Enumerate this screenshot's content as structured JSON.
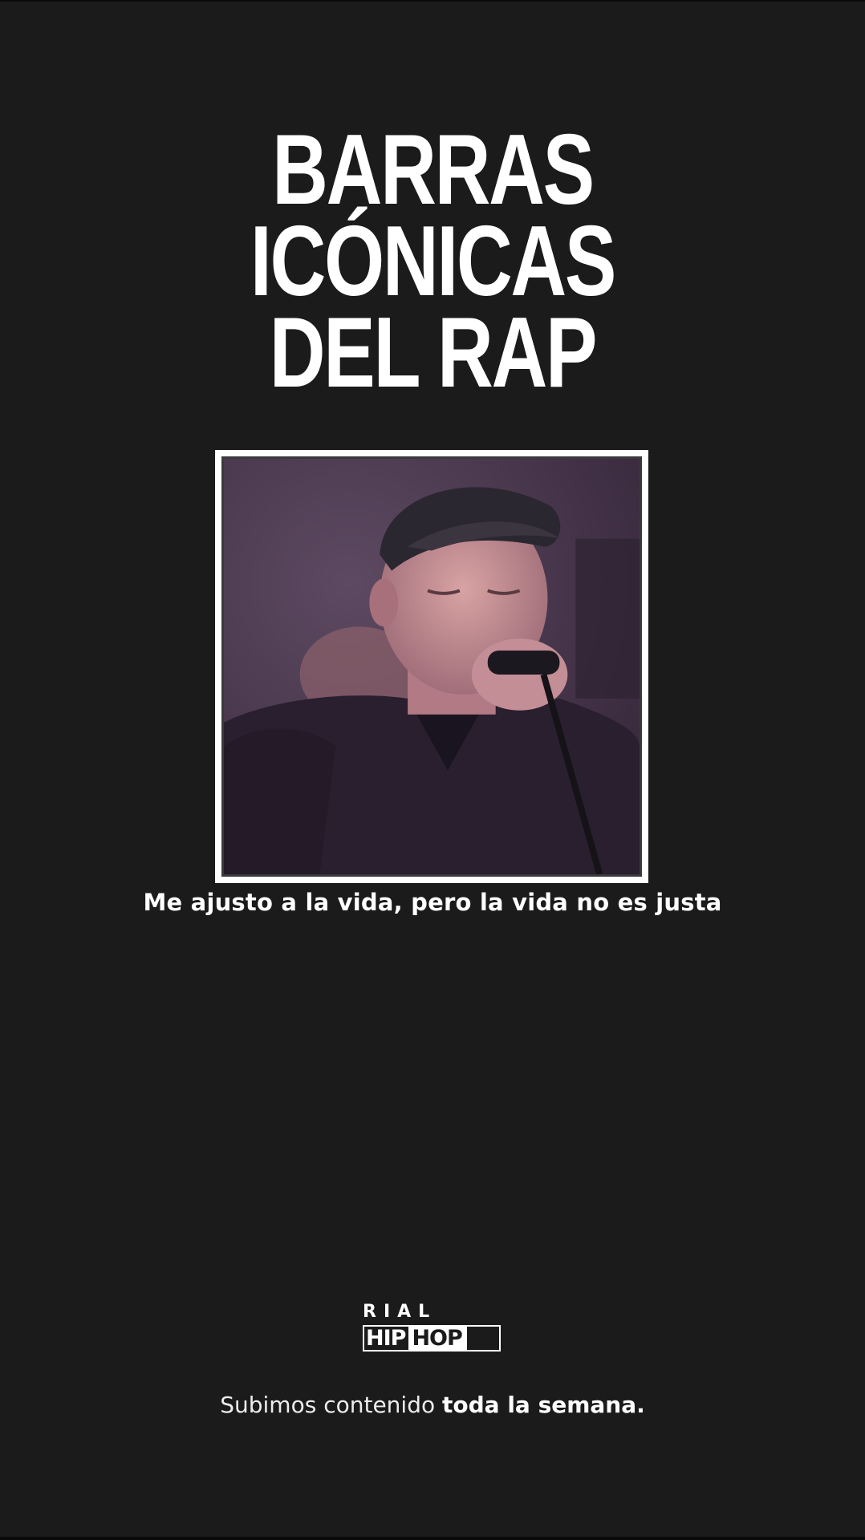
{
  "title": {
    "line1": "BARRAS ICÓNICAS",
    "line2": "DEL RAP"
  },
  "photo": {
    "icon": "performer-photo",
    "colors": {
      "background": "#4a3a4e",
      "frame": "#ffffff"
    }
  },
  "caption": "Me ajusto a la vida, pero la vida no es justa",
  "logo": {
    "top": "RIAL",
    "hip": "HIP",
    "hop": "HOP"
  },
  "footer": {
    "normal": "Subimos contenido ",
    "bold": "toda la semana."
  },
  "colors": {
    "background": "#1b1b1b",
    "text": "#ffffff"
  }
}
